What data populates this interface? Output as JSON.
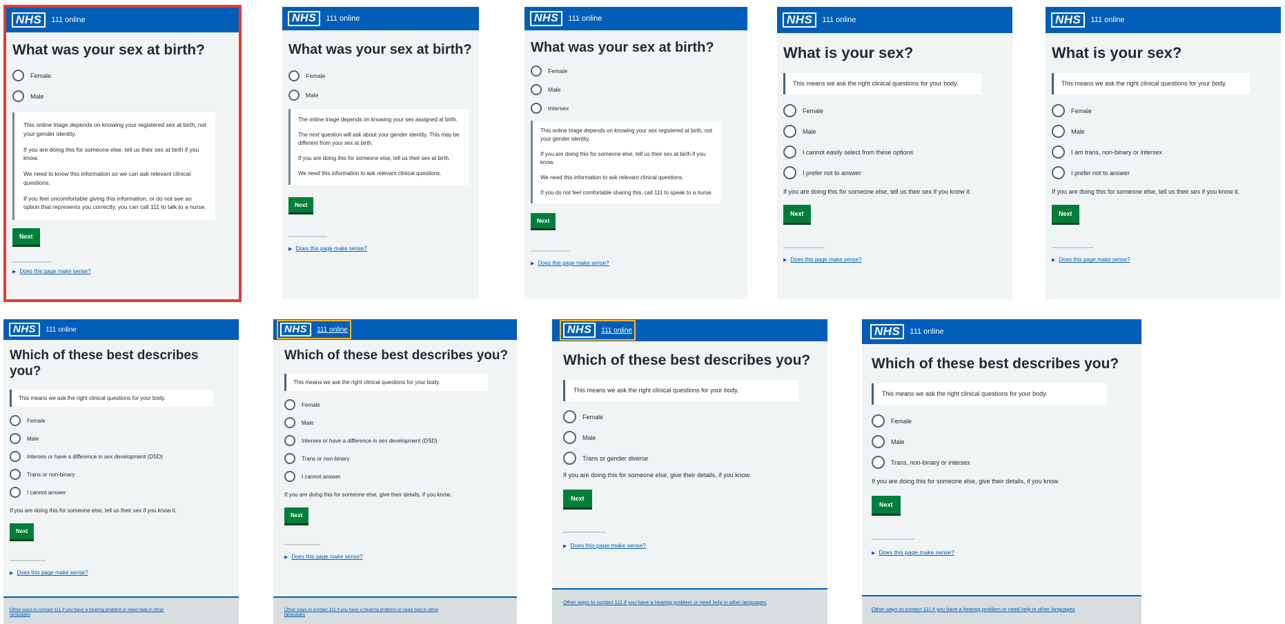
{
  "header": {
    "logo": "NHS",
    "service": "111 online"
  },
  "cards": [
    {
      "heading": "What was your sex at birth?",
      "options": [
        "Female",
        "Male"
      ],
      "inset": [
        "This online triage depends on knowing your registered sex at birth, not your gender identity.",
        "If you are doing this for someone else, tell us their sex at birth if you know.",
        "We need to know this information so we can ask relevant clinical questions.",
        "If you feel uncomfortable giving this information, or do not see an option that represents you correctly, you can call 111 to talk to a nurse."
      ],
      "button": "Next",
      "details": "Does this page make sense?"
    },
    {
      "heading": "What was your sex at birth?",
      "options": [
        "Female",
        "Male"
      ],
      "inset": [
        "The online triage depends on knowing your sex assigned at birth.",
        "The next question will ask about your gender identity. This may be different from your sex at birth.",
        "If you are doing this for someone else, tell us their sex at birth.",
        "We need this information to ask relevant clinical questions."
      ],
      "button": "Next",
      "details": "Does this page make sense?"
    },
    {
      "heading": "What was your sex at birth?",
      "options": [
        "Female",
        "Male",
        "Intersex"
      ],
      "inset": [
        "This online triage depends on knowing your sex registered at birth, not your gender identity.",
        "If you are doing this for someone else, tell us their sex at birth if you know.",
        "We need this information to ask relevant clinical questions.",
        "If you do not feel comfortable sharing this, call 111 to speak to a nurse."
      ],
      "button": "Next",
      "details": "Does this page make sense?"
    },
    {
      "heading": "What is your sex?",
      "hint": "This means we ask the right clinical questions for your body.",
      "options": [
        "Female",
        "Male",
        "I cannot easily select from these options",
        "I prefer not to answer"
      ],
      "note": "If you are doing this for someone else, tell us their sex if you know it.",
      "button": "Next",
      "details": "Does this page make sense?"
    },
    {
      "heading": "What is your sex?",
      "hint": "This means we ask the right clinical questions for your body.",
      "options": [
        "Female",
        "Male",
        "I am trans, non-binary or intersex",
        "I prefer not to answer"
      ],
      "note": "If you are doing this for someone else, tell us their sex if you know it.",
      "button": "Next",
      "details": "Does this page make sense?"
    },
    {
      "heading": "Which of these best describes you?",
      "hint": "This means we ask the right clinical questions for your body.",
      "options": [
        "Female",
        "Male",
        "Intersex or have a difference in sex development (DSD)",
        "Trans or non-binary",
        "I cannot answer"
      ],
      "note": "If you are doing this for someone else, tell us their sex if you know it.",
      "button": "Next",
      "details": "Does this page make sense?",
      "footer": "Other ways to contact 111 if you have a hearing problem or need help in other languages"
    },
    {
      "heading": "Which of these best describes you?",
      "hint": "This means we ask the right clinical questions for your body.",
      "options": [
        "Female",
        "Male",
        "Intersex or have a difference in sex development (DSD)",
        "Trans or non-binary",
        "I cannot answer"
      ],
      "note": "If you are doing this for someone else, give their details, if you know.",
      "button": "Next",
      "details": "Does this page make sense?",
      "footer": "Other ways to contact 111 if you have a hearing problem or need help in other languages"
    },
    {
      "heading": "Which of these best describes you?",
      "hint": "This means we ask the right clinical questions for your body.",
      "options": [
        "Female",
        "Male",
        "Trans or gender diverse"
      ],
      "note": "If you are doing this for someone else, give their details, if you know.",
      "button": "Next",
      "details": "Does this page make sense?",
      "footer": "Other ways to contact 111 if you have a hearing problem or need help in other languages"
    },
    {
      "heading": "Which of these best describes you?",
      "hint": "This means we ask the right clinical questions for your body.",
      "options": [
        "Female",
        "Male",
        "Trans, non-binary or intersex"
      ],
      "note": "If you are doing this for someone else, give their details, if you know.",
      "button": "Next",
      "details": "Does this page make sense?",
      "footer": "Other ways to contact 111 if you have a hearing problem or need help in other languages"
    }
  ]
}
